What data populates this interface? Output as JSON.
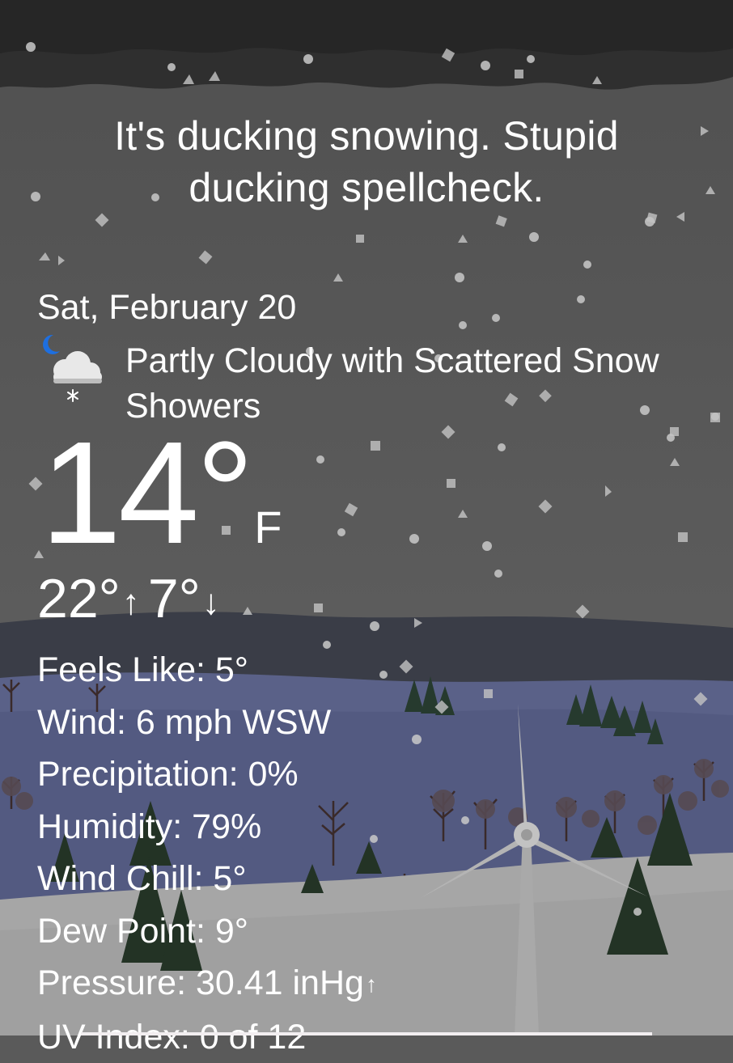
{
  "headline": "It's ducking snowing. Stupid ducking spellcheck.",
  "date": "Sat, February 20",
  "condition": {
    "icon": "night-partly-cloudy-snow-icon",
    "text": "Partly Cloudy with Scattered Snow Showers"
  },
  "temperature": {
    "value": "14°",
    "unit": "F"
  },
  "high_low": {
    "high": "22°",
    "high_icon": "arrow-up-icon",
    "low": "7°",
    "low_icon": "arrow-down-icon"
  },
  "details": {
    "feels_like": "Feels Like: 5°",
    "wind": "Wind: 6 mph WSW",
    "precipitation": "Precipitation: 0%",
    "humidity": "Humidity: 79%",
    "wind_chill": "Wind Chill: 5°",
    "dew_point": "Dew Point: 9°",
    "pressure": "Pressure: 30.41 inHg",
    "pressure_trend_icon": "arrow-up-small-icon",
    "uv_index": "UV Index: 0 of 12"
  },
  "colors": {
    "sky": "#5a5a5a",
    "storm_cloud": "#2e2e2e",
    "far_hills": "#3a3d47",
    "mid_ground": "#5a6188",
    "snow_ground": "#a4a4a4",
    "tree": "#2b3a2c",
    "text": "#ffffff",
    "moon": "#1e6fe0"
  }
}
